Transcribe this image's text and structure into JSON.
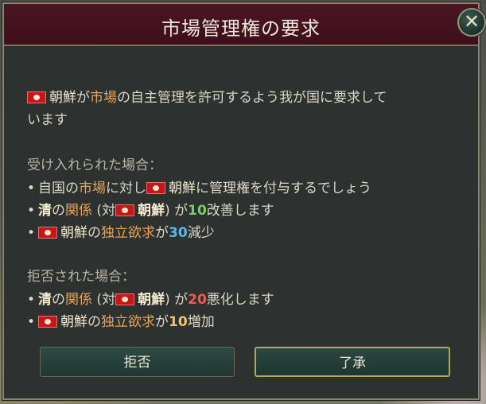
{
  "dialog": {
    "title": "市場管理権の要求",
    "close_label": "✕",
    "intro_line1_a": "朝鮮",
    "intro_line1_b": "が",
    "intro_line1_c": "市場",
    "intro_line1_d": "の自主管理を許可するよう我が国に要求して",
    "intro_line2": "います",
    "accepted_header": "受け入れられた場合：",
    "accepted_1_a": "自国の",
    "accepted_1_b": "市場",
    "accepted_1_c": "に対し",
    "accepted_1_d": "朝鮮",
    "accepted_1_e": "に管理権を付与するでしょう",
    "accepted_2_a": "清",
    "accepted_2_b": "の",
    "accepted_2_c": "関係",
    "accepted_2_d": " (対",
    "accepted_2_e": "朝鮮",
    "accepted_2_f": ") が",
    "accepted_2_g": "10",
    "accepted_2_h": "改善します",
    "accepted_3_a": "朝鮮",
    "accepted_3_b": "の",
    "accepted_3_c": "独立欲求",
    "accepted_3_d": "が",
    "accepted_3_e": "30",
    "accepted_3_f": "減少",
    "declined_header": "拒否された場合：",
    "declined_1_a": "清",
    "declined_1_b": "の",
    "declined_1_c": "関係",
    "declined_1_d": " (対",
    "declined_1_e": "朝鮮",
    "declined_1_f": ") が",
    "declined_1_g": "20",
    "declined_1_h": "悪化します",
    "declined_2_a": "朝鮮",
    "declined_2_b": "の",
    "declined_2_c": "独立欲求",
    "declined_2_d": "が",
    "declined_2_e": "10",
    "declined_2_f": "増加",
    "decline_button": "拒否",
    "accept_button": "了承"
  },
  "icons": {
    "close": "close-icon",
    "flag": "korea-flag-icon"
  },
  "colors": {
    "header_bg": "#4b1522",
    "panel_bg": "#2e3231",
    "accent_gold": "#b8a45a",
    "positive": "#77d35b",
    "negative": "#f05a57",
    "info": "#59b9ef"
  }
}
